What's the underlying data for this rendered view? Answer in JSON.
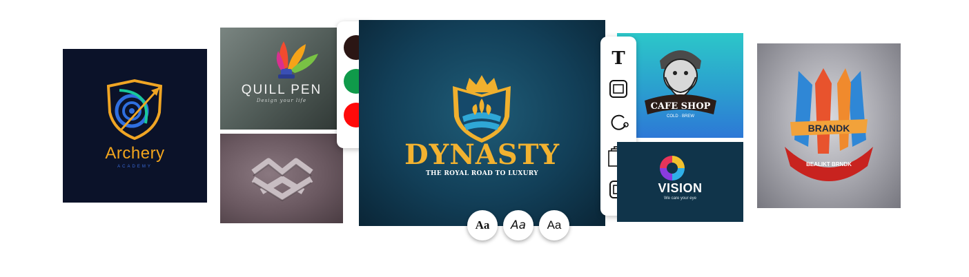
{
  "logos": {
    "archery": {
      "name": "Archery",
      "tagline": "ACADEMY"
    },
    "quill": {
      "name": "QUILL PEN",
      "tagline": "Design your life"
    },
    "dynasty": {
      "name": "DYNASTY",
      "tagline": "THE ROYAL ROAD TO LUXURY"
    },
    "cafe": {
      "name": "CAFE SHOP",
      "tagline": "COLD · BREW"
    },
    "vision": {
      "name": "VISION",
      "tagline": "We care your eye"
    },
    "brand": {
      "name": "BRANDK",
      "tagline": "BEALIKT  BRNDK"
    }
  },
  "palette": {
    "colors": [
      "#2b1614",
      "#0f9a4a",
      "#ff0a0a"
    ]
  },
  "font_options": [
    "Aa",
    "Aa",
    "Aa"
  ],
  "tools": [
    "text-icon",
    "frame-icon",
    "rotate-icon",
    "layers-icon",
    "frame-icon"
  ]
}
